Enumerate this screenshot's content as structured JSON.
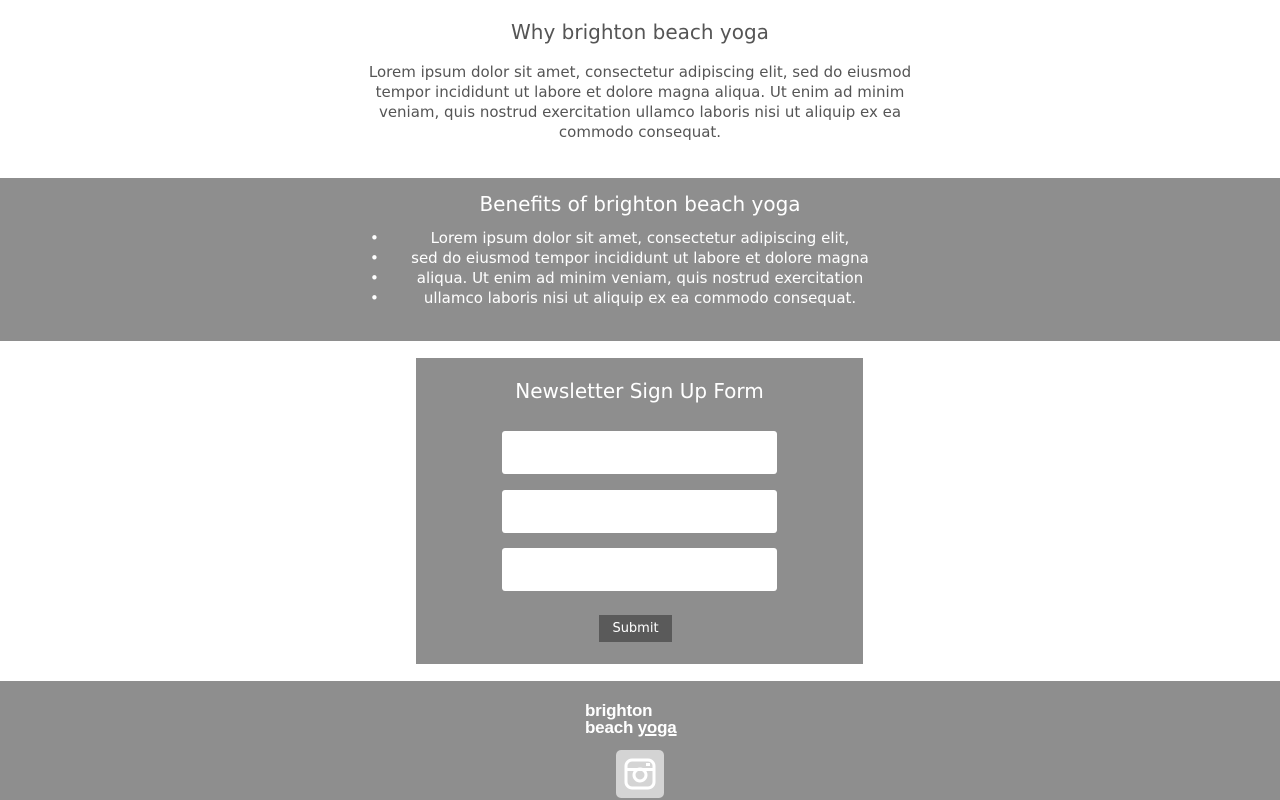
{
  "why": {
    "title": "Why brighton beach yoga",
    "body": "Lorem ipsum dolor sit amet, consectetur adipiscing elit, sed do eiusmod tempor incididunt ut labore et dolore magna aliqua. Ut enim ad minim veniam, quis nostrud exercitation ullamco laboris nisi ut aliquip ex ea commodo consequat."
  },
  "benefits": {
    "title": "Benefits of brighton beach yoga",
    "items": [
      "Lorem ipsum dolor sit amet, consectetur adipiscing elit,",
      "sed do eiusmod tempor incididunt ut labore et dolore magna",
      "aliqua. Ut enim ad minim veniam, quis nostrud exercitation",
      "ullamco laboris nisi ut aliquip ex ea commodo consequat."
    ]
  },
  "newsletter": {
    "title": "Newsletter Sign Up Form",
    "field_1_value": "",
    "field_2_value": "",
    "field_3_value": "",
    "submit_label": "Submit"
  },
  "footer": {
    "logo_line_1": "brighton",
    "logo_line_2a": "beach",
    "logo_line_2b": "yoga",
    "social_icon": "instagram-icon"
  },
  "colors": {
    "section_gray": "#8e8e8e",
    "button_dark": "#5a5a5a",
    "text_gray": "#555555",
    "icon_bg": "#d4d4d4"
  }
}
